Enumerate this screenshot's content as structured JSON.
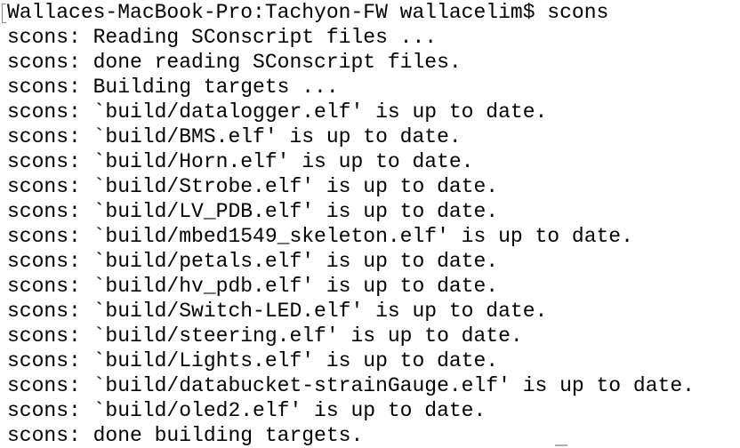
{
  "terminal": {
    "lines": [
      "Wallaces-MacBook-Pro:Tachyon-FW wallacelim$ scons",
      "scons: Reading SConscript files ...",
      "scons: done reading SConscript files.",
      "scons: Building targets ...",
      "scons: `build/datalogger.elf' is up to date.",
      "scons: `build/BMS.elf' is up to date.",
      "scons: `build/Horn.elf' is up to date.",
      "scons: `build/Strobe.elf' is up to date.",
      "scons: `build/LV_PDB.elf' is up to date.",
      "scons: `build/mbed1549_skeleton.elf' is up to date.",
      "scons: `build/petals.elf' is up to date.",
      "scons: `build/hv_pdb.elf' is up to date.",
      "scons: `build/Switch-LED.elf' is up to date.",
      "scons: `build/steering.elf' is up to date.",
      "scons: `build/Lights.elf' is up to date.",
      "scons: `build/databucket-strainGauge.elf' is up to date.",
      "scons: `build/oled2.elf' is up to date.",
      "scons: done building targets."
    ]
  }
}
